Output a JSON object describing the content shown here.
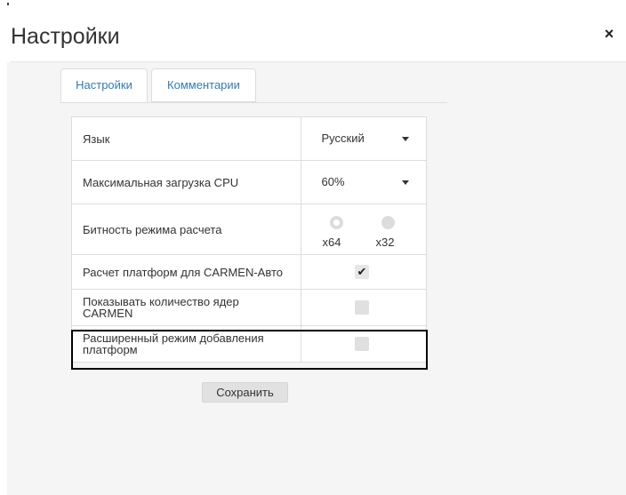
{
  "dialog": {
    "title": "Настройки",
    "close_icon": "×"
  },
  "tabs": [
    {
      "label": "Настройки",
      "active": true
    },
    {
      "label": "Комментарии",
      "active": false
    }
  ],
  "settings": {
    "language": {
      "label": "Язык",
      "value": "Русский"
    },
    "cpu_load": {
      "label": "Максимальная загрузка CPU",
      "value": "60%"
    },
    "bitness": {
      "label": "Битность режима расчета",
      "options": [
        {
          "label": "x64",
          "selected": true
        },
        {
          "label": "x32",
          "selected": false
        }
      ]
    },
    "carmen_auto_platforms": {
      "label": "Расчет платформ для CARMEN-Авто",
      "checked": true
    },
    "show_cores": {
      "label": "Показывать количество ядер CARMEN",
      "checked": false
    },
    "extended_add_mode": {
      "label": "Расширенный режим добавления платформ",
      "checked": false
    }
  },
  "save_button": {
    "label": "Сохранить"
  },
  "colors": {
    "tab_text": "#337ab7",
    "body_background": "#f5f5f5",
    "border": "#dddddd",
    "highlight_border": "#000000"
  }
}
